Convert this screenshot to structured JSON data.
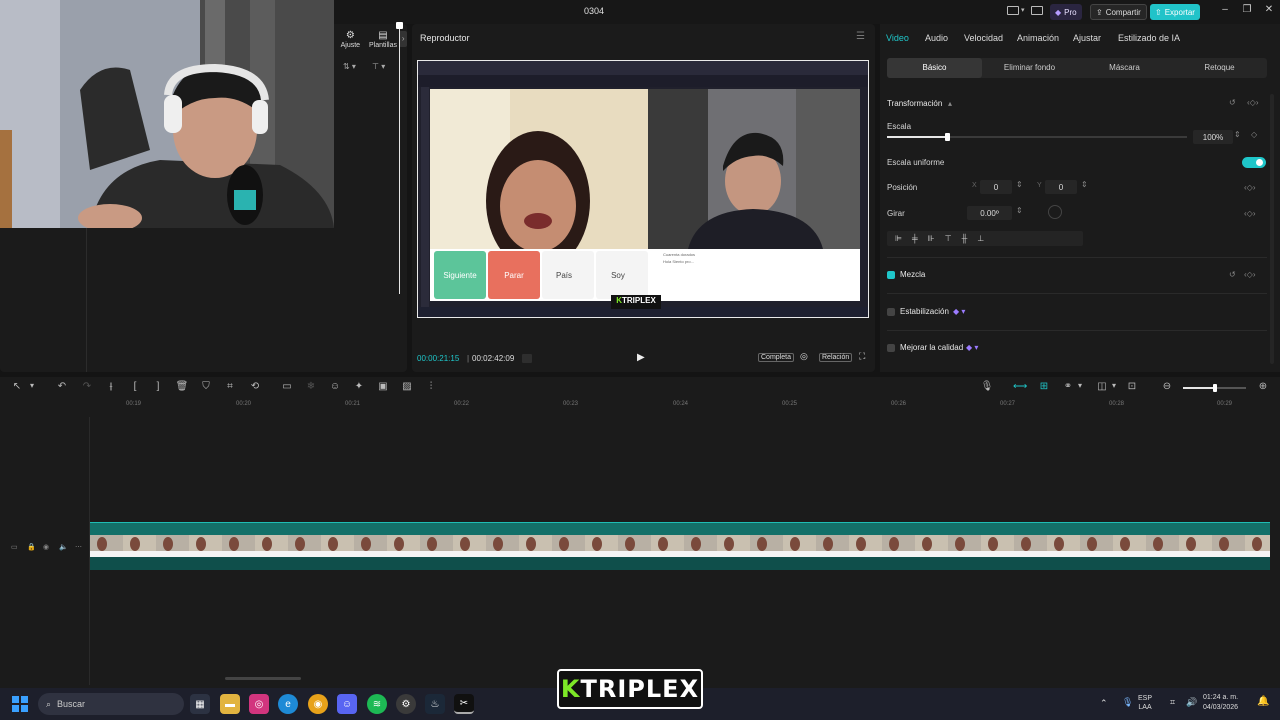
{
  "titlebar": {
    "title": "0304",
    "pro": "Pro",
    "share": "Compartir",
    "export": "Exportar"
  },
  "left_panel": {
    "tools": [
      "Ajuste",
      "Plantillas"
    ]
  },
  "player": {
    "title": "Reproductor",
    "time_current": "00:00:21:15",
    "time_total": "00:02:42:09",
    "btn_full": "Completa",
    "btn_ratio": "Relación",
    "preview": {
      "buttons": [
        "Siguiente",
        "Parar",
        "País",
        "Soy"
      ],
      "chat_name": "Cuarenta dorados",
      "chat_msg": "Hola Siento pro..."
    }
  },
  "properties": {
    "tabs": [
      "Video",
      "Audio",
      "Velocidad",
      "Animación",
      "Ajustar",
      "Estilizado de IA"
    ],
    "subtabs": [
      "Básico",
      "Eliminar fondo",
      "Máscara",
      "Retoque"
    ],
    "transform_title": "Transformación",
    "scale_label": "Escala",
    "scale_value": "100%",
    "scale_fraction": 0.2,
    "uniform_label": "Escala uniforme",
    "position_label": "Posición",
    "x_axis": "X",
    "x_value": "0",
    "y_axis": "Y",
    "y_value": "0",
    "rotate_label": "Girar",
    "rotate_value": "0.00º",
    "blend_label": "Mezcla",
    "stabilize_label": "Estabilización",
    "enhance_label": "Mejorar la calidad",
    "accent": "#1fc6c9"
  },
  "timeline": {
    "ruler": [
      "00:19",
      "00:20",
      "00:21",
      "00:22",
      "00:23",
      "00:24",
      "00:25",
      "00:26",
      "00:27",
      "00:28",
      "00:29"
    ]
  },
  "taskbar": {
    "search_placeholder": "Buscar",
    "lang": "ESP",
    "lang2": "LAA",
    "time": "01:24 a. m.",
    "date": "04/03/2026"
  },
  "watermark": {
    "k": "K",
    "rest": "TRIPLEX"
  }
}
